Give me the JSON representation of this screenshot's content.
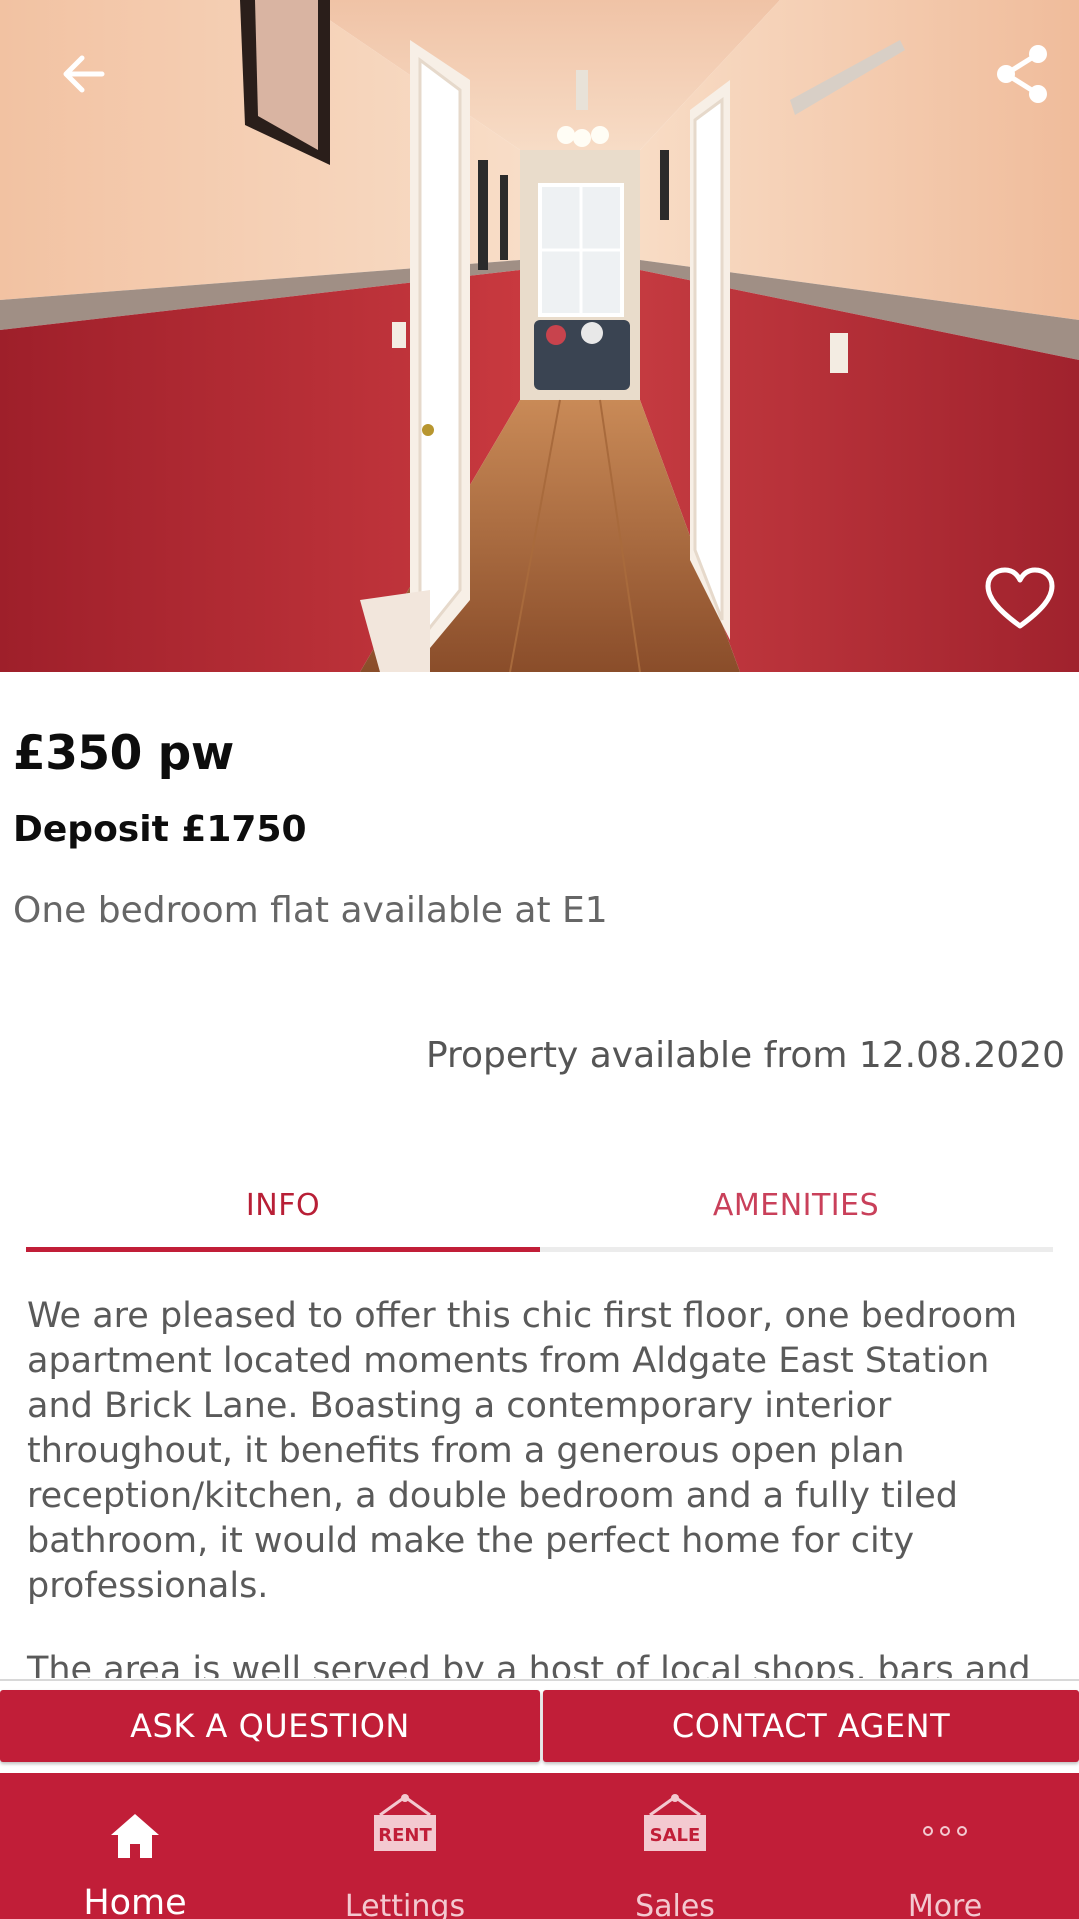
{
  "listing": {
    "price": "£350 pw",
    "deposit": "Deposit £1750",
    "summary": "One bedroom flat available at E1",
    "available": "Property available from 12.08.2020"
  },
  "tabs": [
    {
      "label": "INFO",
      "active": true
    },
    {
      "label": "AMENITIES",
      "active": false
    }
  ],
  "description": {
    "paragraph1": "We are pleased to offer this chic first floor, one bedroom apartment located moments from Aldgate East Station and Brick Lane. Boasting a contemporary interior throughout, it benefits from a generous open plan reception/kitchen, a double bedroom and a fully tiled bathroom, it would make the perfect home for city professionals.",
    "paragraph2": "The area is well served by a host of local shops, bars and"
  },
  "actions": {
    "ask": "ASK A QUESTION",
    "contact": "CONTACT AGENT"
  },
  "nav": {
    "items": [
      {
        "label": "Home",
        "icon": "home-icon",
        "active": true
      },
      {
        "label": "Lettings",
        "icon": "rent-sign-icon",
        "sign_text": "RENT"
      },
      {
        "label": "Sales",
        "icon": "sale-sign-icon",
        "sign_text": "SALE"
      },
      {
        "label": "More",
        "icon": "more-dots-icon"
      }
    ]
  },
  "hero": {
    "icons": [
      "back-arrow-icon",
      "share-icon",
      "heart-icon"
    ]
  },
  "colors": {
    "brand": "#c11e38",
    "wall_red": "#b52a35",
    "wall_cream": "#f3c9ad"
  }
}
